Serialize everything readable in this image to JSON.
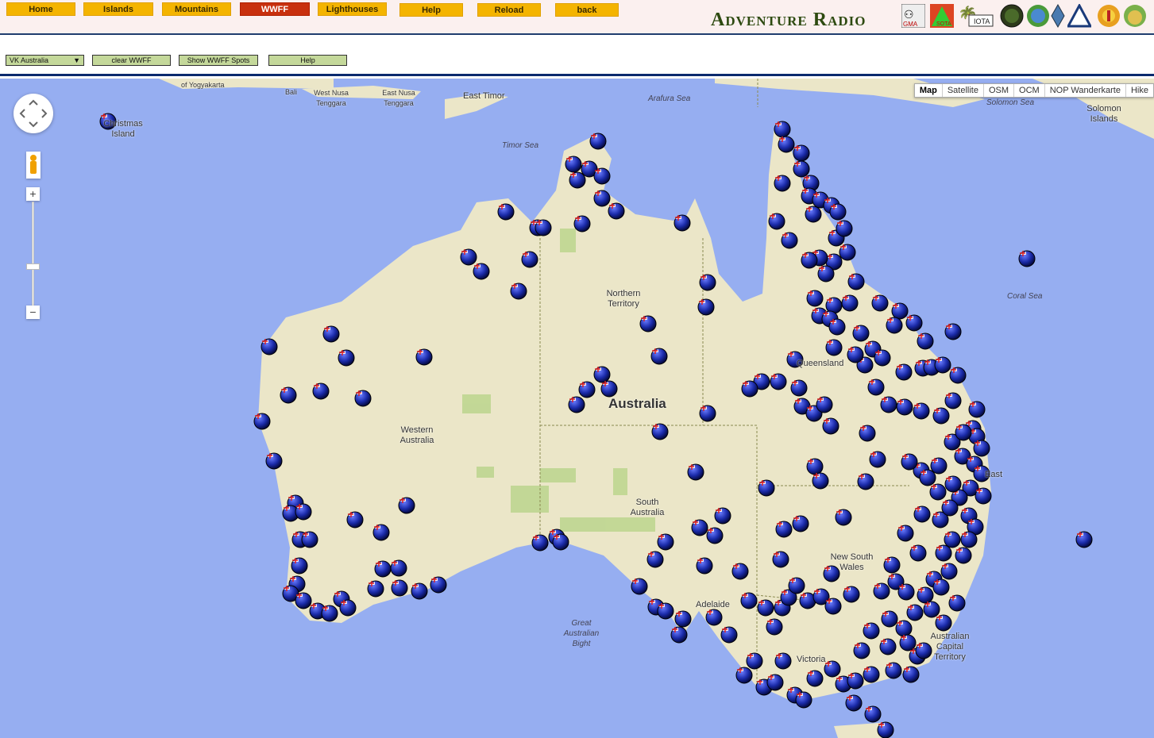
{
  "nav": [
    {
      "label": "Home"
    },
    {
      "label": "Islands"
    },
    {
      "label": "Mountains"
    },
    {
      "label": "WWFF",
      "active": true
    },
    {
      "label": "Lighthouses"
    },
    {
      "label": "Help"
    },
    {
      "label": "Reload"
    },
    {
      "label": "back"
    }
  ],
  "brand": "Adventure Radio",
  "logos": [
    "gma-logo",
    "sota-logo",
    "iota-logo",
    "green-circle-logo",
    "wwff-logo",
    "diamond-logo",
    "triangle-logo",
    "lighthouse-logo",
    "globe-logo"
  ],
  "toolbar": {
    "region_select": "VK Australia",
    "clear": "clear WWFF",
    "show_spots": "Show WWFF Spots",
    "help": "Help"
  },
  "map": {
    "types": [
      "Map",
      "Satellite",
      "OSM",
      "OCM",
      "NOP Wanderkarte",
      "Hike"
    ],
    "selected_type": "Map",
    "labels": {
      "yogyakarta": "of Yogyakarta",
      "bali": "Bali",
      "west_nusa": "West Nusa Tenggara",
      "east_nusa": "East Nusa Tenggara",
      "east_timor": "East Timor",
      "arafura": "Arafura Sea",
      "timor_sea": "Timor Sea",
      "solomon_sea": "Solomon Sea",
      "solomon_islands": "Solomon Islands",
      "coral_sea": "Coral Sea",
      "christmas": "Christmas Island",
      "nt": "Northern Territory",
      "wa": "Western Australia",
      "australia": "Australia",
      "sa": "South Australia",
      "qld": "Queensland",
      "nsw": "New South Wales",
      "act": "Australian Capital Territory",
      "vic": "Victoria",
      "adelaide": "Adelaide",
      "bight": "Great Australian Bight",
      "east": "East"
    },
    "marker_icon": "australian-flag-marker-icon",
    "colors": {
      "ocean": "#96aef1",
      "land": "#ebe6c8",
      "park": "#b9d48a"
    }
  }
}
